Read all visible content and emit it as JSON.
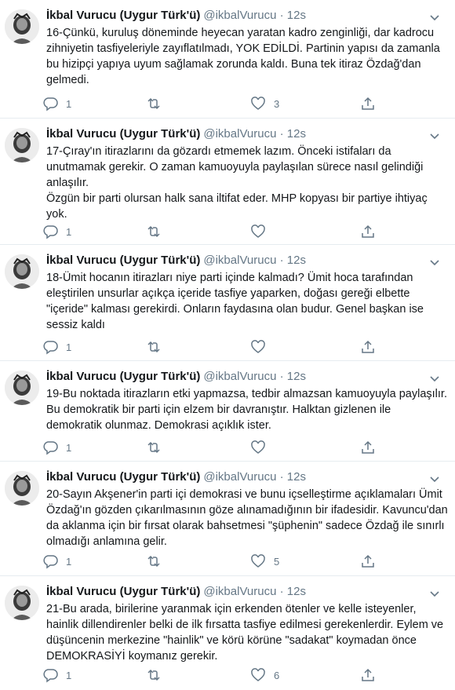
{
  "tweets": [
    {
      "name": "İkbal Vurucu (Uygur Türk'ü)",
      "handle": "@ikbalVurucu",
      "dot": "·",
      "time": "12s",
      "text": "16-Çünkü, kuruluş döneminde heyecan yaratan kadro zenginliği, dar kadrocu zihniyetin tasfiyeleriyle zayıflatılmadı, YOK EDİLDİ. Partinin yapısı da zamanla bu hizipçi yapıya uyum sağlamak zorunda kaldı. Buna tek itiraz Özdağ'dan gelmedi.",
      "replies": "1",
      "retweets": "",
      "likes": "3"
    },
    {
      "name": "İkbal Vurucu (Uygur Türk'ü)",
      "handle": "@ikbalVurucu",
      "dot": "·",
      "time": "12s",
      "text": "17-Çıray'ın itirazlarını da gözardı etmemek lazım. Önceki istifaları da unutmamak gerekir. O zaman kamuoyuyla paylaşılan sürece nasıl gelindiği anlaşılır.\nÖzgün bir parti olursan halk sana iltifat eder. MHP kopyası bir partiye ihtiyaç yok.",
      "replies": "1",
      "retweets": "",
      "likes": ""
    },
    {
      "name": "İkbal Vurucu (Uygur Türk'ü)",
      "handle": "@ikbalVurucu",
      "dot": "·",
      "time": "12s",
      "text": "18-Ümit hocanın itirazları niye parti içinde kalmadı? Ümit hoca tarafından eleştirilen unsurlar açıkça içeride tasfiye yaparken, doğası gereği elbette \"içeride\" kalması gerekirdi. Onların faydasına olan budur. Genel başkan ise sessiz kaldı",
      "replies": "1",
      "retweets": "",
      "likes": ""
    },
    {
      "name": "İkbal Vurucu (Uygur Türk'ü)",
      "handle": "@ikbalVurucu",
      "dot": "·",
      "time": "12s",
      "text": "19-Bu noktada itirazların etki yapmazsa, tedbir almazsan kamuoyuyla paylaşılır. Bu demokratik bir parti için elzem bir davranıştır. Halktan gizlenen ile demokratik olunmaz. Demokrasi açıklık ister.",
      "replies": "1",
      "retweets": "",
      "likes": ""
    },
    {
      "name": "İkbal Vurucu (Uygur Türk'ü)",
      "handle": "@ikbalVurucu",
      "dot": "·",
      "time": "12s",
      "text": "20-Sayın Akşener'in parti içi demokrasi ve bunu içselleştirme açıklamaları Ümit Özdağ'ın gözden çıkarılmasının göze alınamadığının bir ifadesidir. Kavuncu'dan da aklanma için bir fırsat olarak bahsetmesi \"şüphenin\" sadece Özdağ ile sınırlı olmadığı anlamına gelir.",
      "replies": "1",
      "retweets": "",
      "likes": "5"
    },
    {
      "name": "İkbal Vurucu (Uygur Türk'ü)",
      "handle": "@ikbalVurucu",
      "dot": "·",
      "time": "12s",
      "text": "21-Bu arada, birilerine yaranmak için erkenden ötenler ve kelle isteyenler, hainlik dillendirenler belki de ilk fırsatta tasfiye edilmesi gerekenlerdir. Eylem ve düşüncenin merkezine \"hainlik\" ve körü körüne \"sadakat\" koymadan önce DEMOKRASİYİ koymanız gerekir.",
      "replies": "1",
      "retweets": "",
      "likes": "6"
    }
  ],
  "icons": {
    "reply": "reply-icon",
    "retweet": "retweet-icon",
    "like": "heart-icon",
    "share": "share-icon",
    "more": "chevron-down-icon"
  },
  "colors": {
    "muted": "#657786",
    "text": "#14171a",
    "border": "#e6ecf0"
  }
}
